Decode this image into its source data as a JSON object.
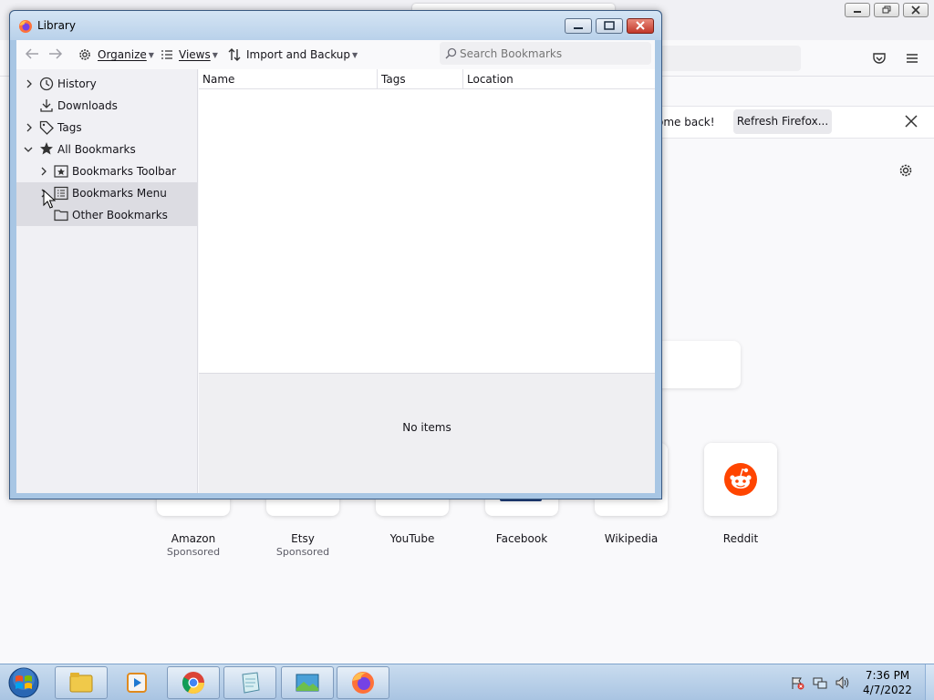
{
  "firefox_bg": {
    "notification_text": "ome back!",
    "refresh_label": "Refresh Firefox...",
    "top_sites": [
      {
        "name": "Amazon",
        "sub": "Sponsored"
      },
      {
        "name": "Etsy",
        "sub": "Sponsored"
      },
      {
        "name": "YouTube",
        "sub": ""
      },
      {
        "name": "Facebook",
        "sub": ""
      },
      {
        "name": "Wikipedia",
        "sub": ""
      },
      {
        "name": "Reddit",
        "sub": ""
      }
    ],
    "reddit_color": "#ff4500"
  },
  "library": {
    "title": "Library",
    "toolbar": {
      "organize": "Organize",
      "views": "Views",
      "import_backup": "Import and Backup",
      "search_placeholder": "Search Bookmarks"
    },
    "sidebar": {
      "items": [
        {
          "label": "History",
          "icon": "clock-icon"
        },
        {
          "label": "Downloads",
          "icon": "download-icon"
        },
        {
          "label": "Tags",
          "icon": "tag-icon"
        },
        {
          "label": "All Bookmarks",
          "icon": "star-icon"
        },
        {
          "label": "Bookmarks Toolbar",
          "icon": "bookmarks-toolbar-icon"
        },
        {
          "label": "Bookmarks Menu",
          "icon": "bookmarks-menu-icon"
        },
        {
          "label": "Other Bookmarks",
          "icon": "folder-icon"
        }
      ]
    },
    "columns": [
      "Name",
      "Tags",
      "Location"
    ],
    "details_text": "No items"
  },
  "taskbar": {
    "time": "7:36 PM",
    "date": "4/7/2022"
  },
  "colors": {
    "selected_row": "#dcdce2",
    "accent_close": "#c2382a"
  }
}
